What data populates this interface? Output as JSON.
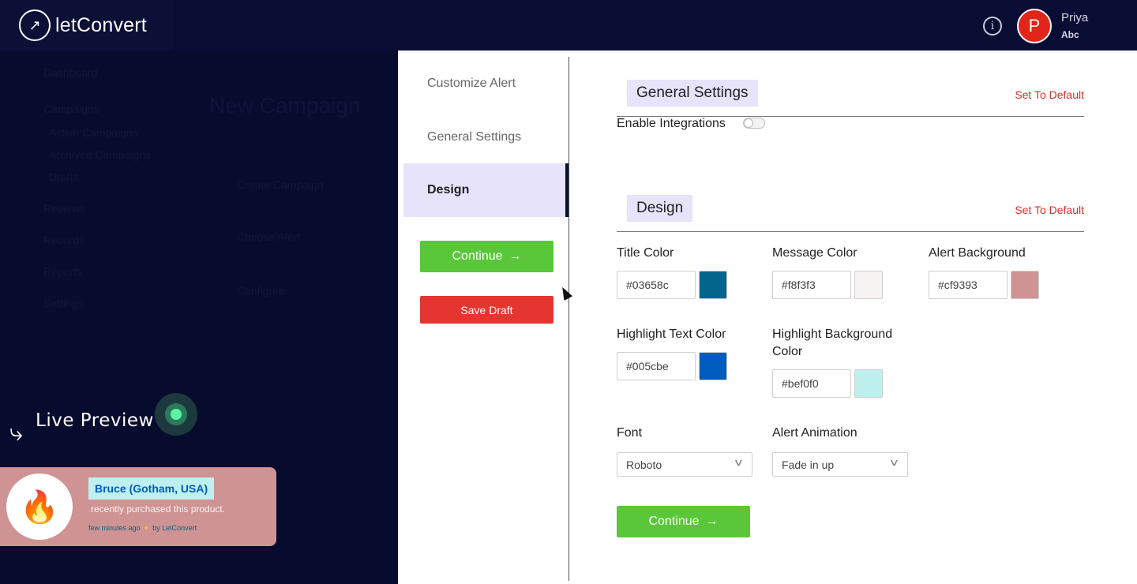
{
  "brand": {
    "name_light": "let",
    "name_bold": "Convert"
  },
  "header": {
    "info_icon": "info-circle-icon",
    "user_initial": "P",
    "user_name": "Priya",
    "user_sub": "Abc"
  },
  "background": {
    "page_title": "New Campaign",
    "nav_items": [
      "Dashboard",
      "Campaigns",
      "Active Campaigns",
      "Archived Campaigns",
      "Drafts",
      "Reviews",
      "Records",
      "Reports",
      "Settings"
    ],
    "form_items": [
      "Create Campaign",
      "Choose Alert",
      "Configure"
    ]
  },
  "live_preview": {
    "label": "Live Preview",
    "notification": {
      "name": "Bruce (Gotham, USA)",
      "message": "recently purchased this product.",
      "time": "few minutes ago",
      "by": "by LetConvert"
    }
  },
  "steps": [
    {
      "label": "Customize Alert",
      "active": false
    },
    {
      "label": "General Settings",
      "active": false
    },
    {
      "label": "Design",
      "active": true
    }
  ],
  "actions": {
    "continue": "Continue",
    "save_draft": "Save Draft"
  },
  "general": {
    "title": "General Settings",
    "set_default": "Set To Default",
    "enable_integrations": "Enable Integrations",
    "enable_integrations_on": false
  },
  "design": {
    "title": "Design",
    "set_default": "Set To Default",
    "title_color": {
      "label": "Title Color",
      "value": "#03658c"
    },
    "message_color": {
      "label": "Message Color",
      "value": "#f8f3f3"
    },
    "alert_background": {
      "label": "Alert Background",
      "value": "#cf9393"
    },
    "highlight_text_color": {
      "label": "Highlight Text Color",
      "value": "#005cbe"
    },
    "highlight_background_color": {
      "label": "Highlight Background Color",
      "value": "#bef0f0"
    },
    "font": {
      "label": "Font",
      "value": "Roboto"
    },
    "alert_animation": {
      "label": "Alert Animation",
      "value": "Fade in up"
    },
    "continue": "Continue"
  },
  "colors": {
    "accent_green": "#5ac63a",
    "danger_red": "#e53530",
    "nav_dark": "#0a0d33",
    "active_step": "#e6e3fa"
  }
}
